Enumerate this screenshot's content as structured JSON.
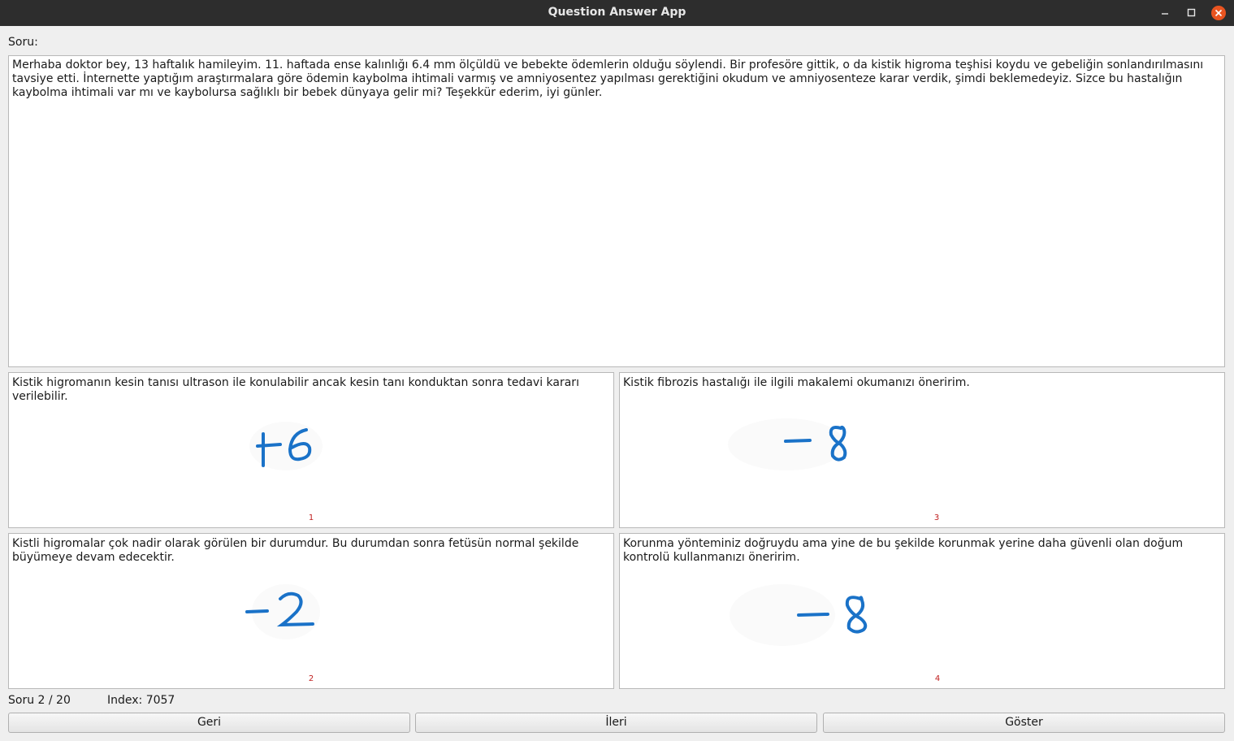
{
  "window": {
    "title": "Question Answer App",
    "controls": [
      "minimize-icon",
      "maximize-icon",
      "close-icon"
    ],
    "close_color": "#e95420"
  },
  "question": {
    "label": "Soru:",
    "text": "Merhaba doktor bey, 13 haftalık hamileyim. 11. haftada ense kalınlığı 6.4 mm ölçüldü ve bebekte ödemlerin olduğu söylendi. Bir profesöre gittik, o da kistik higroma teşhisi koydu ve gebeliğin sonlandırılmasını tavsiye etti. İnternette yaptığım araştırmalara göre ödemin kaybolma ihtimali varmış ve amniyosentez yapılması gerektiğini okudum ve amniyosenteze karar verdik, şimdi beklemedeyiz. Sizce bu hastalığın kaybolma ihtimali var mı ve kaybolursa sağlıklı bir bebek dünyaya gelir mi? Teşekkür ederim, iyi günler."
  },
  "answers": [
    {
      "number": "1",
      "text": "Kistik higromanın kesin tanısı ultrason ile konulabilir ancak kesin tanı konduktan sonra tedavi kararı verilebilir.",
      "score": "+6"
    },
    {
      "number": "2",
      "text": "Kistli higromalar çok nadir olarak görülen bir durumdur. Bu durumdan sonra fetüsün normal şekilde büyümeye devam edecektir.",
      "score": "-2"
    },
    {
      "number": "3",
      "text": "Kistik fibrozis hastalığı ile ilgili makalemi okumanızı öneririm.",
      "score": "-8"
    },
    {
      "number": "4",
      "text": "Korunma yönteminiz doğruydu ama yine de bu şekilde korunmak yerine daha güvenli olan doğum kontrolü kullanmanızı öneririm.",
      "score": "-8"
    }
  ],
  "status": {
    "counter": "Soru 2 / 20",
    "index": "Index: 7057"
  },
  "buttons": {
    "back": "Geri",
    "next": "İleri",
    "show": "Göster"
  },
  "colors": {
    "handwriting": "#1a72c8",
    "answer_number": "#c02020"
  }
}
